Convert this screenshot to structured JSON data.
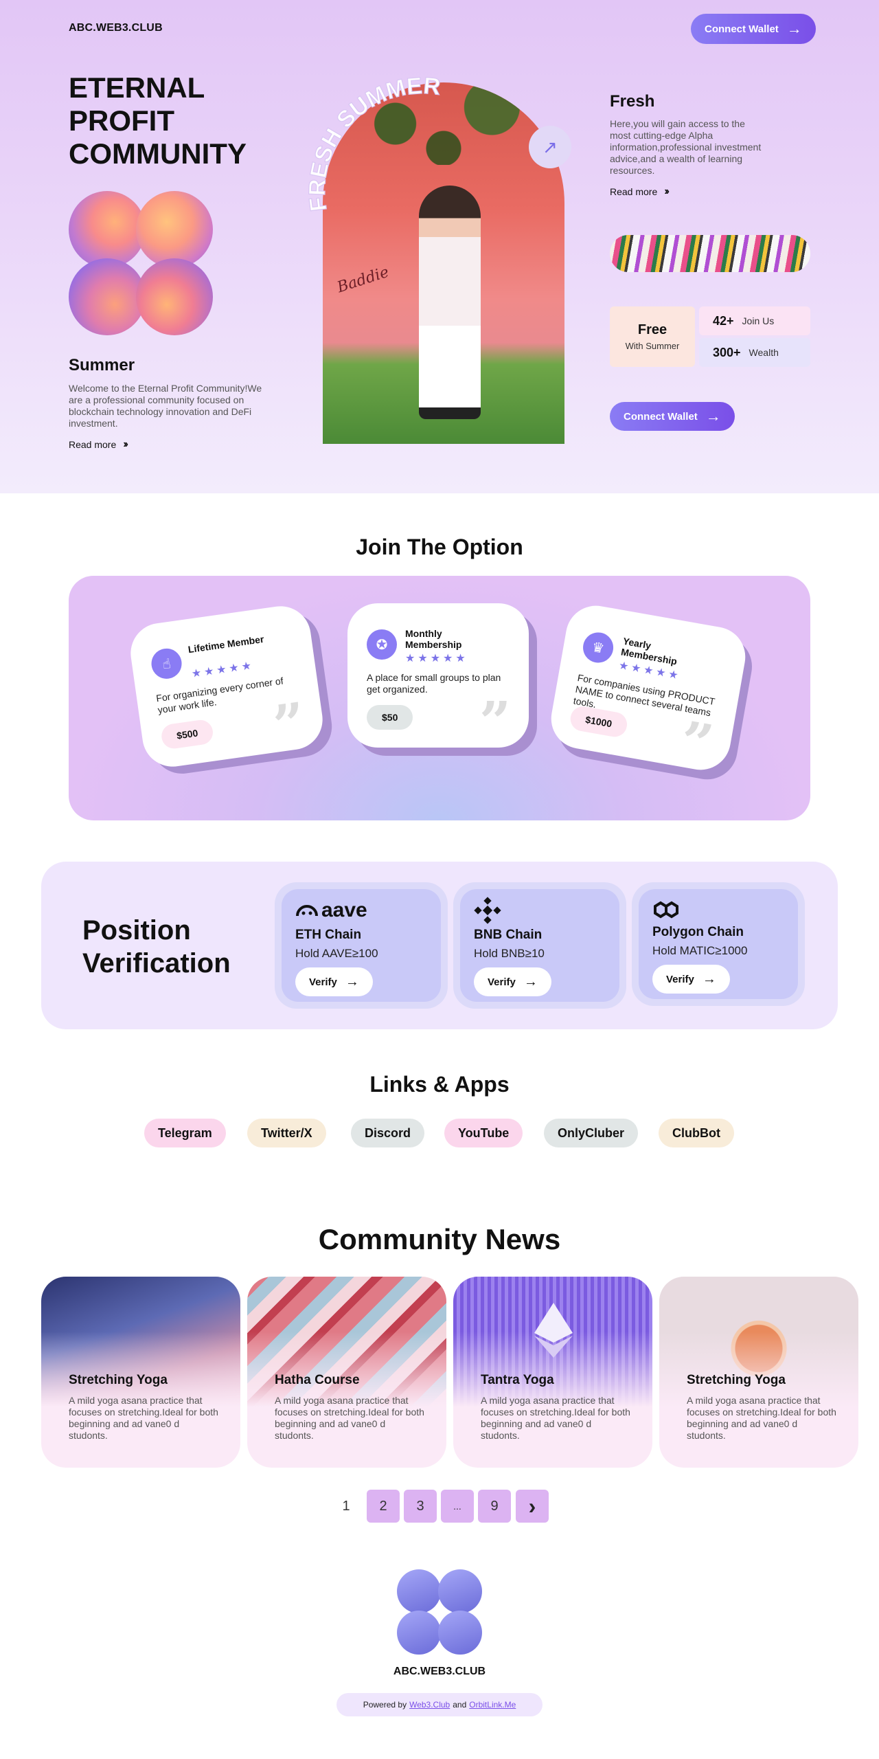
{
  "header": {
    "brand": "ABC.WEB3.CLUB",
    "connect_label": "Connect Wallet"
  },
  "hero": {
    "title": "ETERNAL PROFIT COMMUNITY",
    "arch_text": "FRESH SUMMER",
    "signature": "Baddie",
    "summer": {
      "heading": "Summer",
      "text": "Welcome to the Eternal Profit Community!We are a professional community focused on blockchain technology innovation and DeFi investment.",
      "read_more": "Read more"
    },
    "fresh": {
      "heading": "Fresh",
      "text": "Here,you will gain access to the most cutting-edge Alpha information,professional investment advice,and a wealth of learning resources.",
      "read_more": "Read more"
    },
    "stats": {
      "free_big": "Free",
      "free_small": "With Summer",
      "items": [
        {
          "num": "42+",
          "label": "Join Us",
          "color": "#fbe3f4"
        },
        {
          "num": "300+",
          "label": "Wealth",
          "color": "#e7e3fb"
        }
      ]
    },
    "connect_label": "Connect Wallet"
  },
  "join": {
    "title": "Join The Option",
    "cards": [
      {
        "name": "Lifetime Member",
        "stars": "★★★★★",
        "desc": "For organizing every corner of your work life.",
        "price": "$500",
        "price_bg": "#fde6f1",
        "icon": "hand-pointer-icon"
      },
      {
        "name": "Monthly Membership",
        "stars": "★★★★★",
        "desc": "A place for small groups to plan get organized.",
        "price": "$50",
        "price_bg": "#e1e6e6",
        "icon": "badge-icon"
      },
      {
        "name": "Yearly Membership",
        "stars": "★★★★★",
        "desc": "For companies using PRODUCT NAME to connect several teams tools.",
        "price": "$1000",
        "price_bg": "#fde6f1",
        "icon": "crown-icon"
      }
    ]
  },
  "position": {
    "title": "Position Verification",
    "chains": [
      {
        "logo": "aave",
        "name": "ETH Chain",
        "hold": "Hold AAVE≥100",
        "verify": "Verify"
      },
      {
        "logo": "",
        "name": "BNB Chain",
        "hold": "Hold BNB≥10",
        "verify": "Verify"
      },
      {
        "logo": "",
        "name": "Polygon Chain",
        "hold": "Hold MATIC≥1000",
        "verify": "Verify"
      }
    ]
  },
  "links": {
    "title": "Links & Apps",
    "items": [
      {
        "label": "Telegram",
        "color": "#fbd6ec"
      },
      {
        "label": "Twitter/X",
        "color": "#f8ecd9"
      },
      {
        "label": "Discord",
        "color": "#e1e6e6"
      },
      {
        "label": "YouTube",
        "color": "#fbd6ec"
      },
      {
        "label": "OnlyCluber",
        "color": "#e1e6e6"
      },
      {
        "label": "ClubBot",
        "color": "#f8ecd9"
      }
    ]
  },
  "news": {
    "title": "Community News",
    "items": [
      {
        "title": "Stretching Yoga",
        "text": "A mild yoga asana practice that focuses on stretching.Ideal for both beginning and ad   vane0 d studonts."
      },
      {
        "title": "Hatha Course",
        "text": "A mild yoga asana practice that focuses on stretching.Ideal for both beginning and ad   vane0 d studonts."
      },
      {
        "title": "Tantra Yoga",
        "text": "A mild yoga asana practice that focuses on stretching.Ideal for both beginning and ad   vane0 d studonts."
      },
      {
        "title": "Stretching Yoga",
        "text": "A mild yoga asana practice that focuses on stretching.Ideal for both beginning and ad   vane0 d studonts."
      }
    ]
  },
  "pagination": {
    "pages": [
      "1",
      "2",
      "3",
      "...",
      "9"
    ],
    "current": "1",
    "next": "›"
  },
  "footer": {
    "brand": "ABC.WEB3.CLUB",
    "powered_by": "Powered by",
    "link1": "Web3.Club",
    "and": "and",
    "link2": "OrbitLink.Me"
  }
}
